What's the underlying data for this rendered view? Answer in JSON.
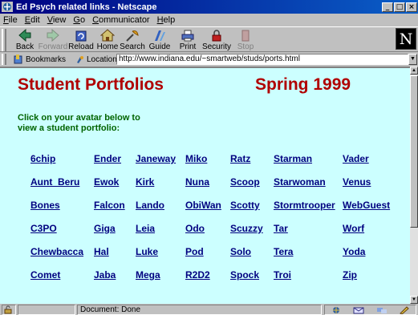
{
  "window": {
    "title": "Ed Psych related links - Netscape"
  },
  "menu": [
    "File",
    "Edit",
    "View",
    "Go",
    "Communicator",
    "Help"
  ],
  "toolbar": {
    "back": "Back",
    "forward": "Forward",
    "reload": "Reload",
    "home": "Home",
    "search": "Search",
    "guide": "Guide",
    "print": "Print",
    "security": "Security",
    "stop": "Stop"
  },
  "location": {
    "bookmarks_label": "Bookmarks",
    "location_label": "Location:",
    "url": "http://www.indiana.edu/~smartweb/studs/ports.html"
  },
  "page": {
    "title": "Student Portfolios",
    "semester": "Spring 1999",
    "instructions": "Click on your avatar below to view a student portfolio:",
    "link_color": "#000080",
    "title_color": "#b00000",
    "background": "#ccffff",
    "names": [
      [
        "6chip",
        "Ender",
        "Janeway",
        "Miko",
        "Ratz",
        "Starman",
        "Vader"
      ],
      [
        "Aunt_Beru",
        "Ewok",
        "Kirk",
        "Nuna",
        "Scoop",
        "Starwoman",
        "Venus"
      ],
      [
        "Bones",
        "Falcon",
        "Lando",
        "ObiWan",
        "Scotty",
        "Stormtrooper",
        "WebGuest"
      ],
      [
        "C3PO",
        "Giga",
        "Leia",
        "Odo",
        "Scuzzy",
        "Tar",
        "Worf"
      ],
      [
        "Chewbacca",
        "Hal",
        "Luke",
        "Pod",
        "Solo",
        "Tera",
        "Yoda"
      ],
      [
        "Comet",
        "Jaba",
        "Mega",
        "R2D2",
        "Spock",
        "Troi",
        "Zip"
      ]
    ]
  },
  "status": {
    "text": "Document: Done"
  }
}
